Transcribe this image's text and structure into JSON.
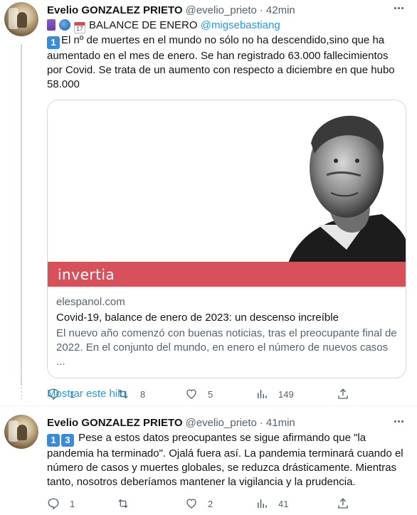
{
  "tweets": [
    {
      "author": "Evelio GONZALEZ PRIETO",
      "handle": "@evelio_prieto",
      "dot": "·",
      "time": "42min",
      "header_line": "BALANCE DE ENERO",
      "calendar_day": "17",
      "mention": "@migsebastiang",
      "keycap": "1",
      "text": "El nº de muertes en el mundo no sólo no ha descendido,sino que ha aumentado en el mes de enero. Se han registrado 63.000 fallecimientos por Covid. Se trata de un aumento con respecto a diciembre en que hubo 58.000",
      "card": {
        "brand": "invertia",
        "domain": "elespanol.com",
        "title": "Covid-19, balance de enero de 2023: un descenso increíble",
        "description": "El nuevo año comenzó con buenas noticias, tras el preocupante final de 2022. En el conjunto del mundo, en enero el número de nuevos casos ..."
      },
      "actions": {
        "replies": "1",
        "retweets": "8",
        "likes": "5",
        "views": "149"
      }
    },
    {
      "author": "Evelio GONZALEZ PRIETO",
      "handle": "@evelio_prieto",
      "dot": "·",
      "time": "41min",
      "keycap_a": "1",
      "keycap_b": "3",
      "text": "Pese a estos datos preocupantes se sigue afirmando que \"la pandemia ha terminado\". Ojalá fuera así. La pandemia terminará cuando el número de casos y muertes globales, se reduzca drásticamente. Mientras tanto, nosotros deberíamos mantener la vigilancia y la prudencia.",
      "actions": {
        "replies": "1",
        "retweets": "",
        "likes": "2",
        "views": "41"
      }
    }
  ],
  "show_thread": "Mostrar este hilo",
  "colors": {
    "link": "#1d9bf0",
    "brand_bar": "#d8515a",
    "keycap": "#3a8cd8"
  },
  "icons": [
    "more-icon",
    "reply-icon",
    "retweet-icon",
    "like-icon",
    "views-icon",
    "share-icon"
  ]
}
